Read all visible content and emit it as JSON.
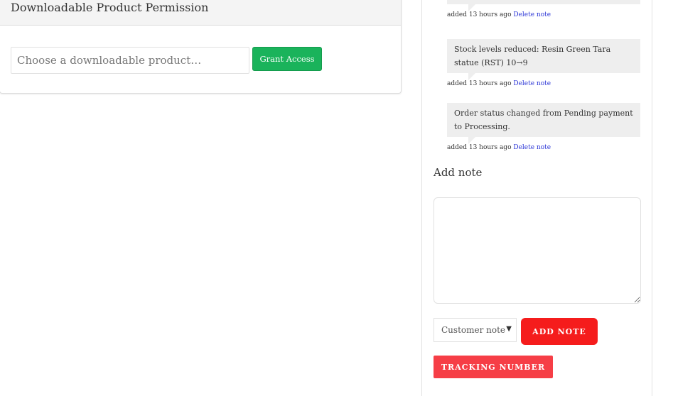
{
  "permission_panel": {
    "title": "Downloadable Product Permission",
    "product_input_placeholder": "Choose a downloadable product…",
    "grant_button_label": "Grant Access"
  },
  "notes": {
    "items": [
      {
        "text": "",
        "meta_prefix": "added 13 hours ago",
        "delete_label": "Delete note"
      },
      {
        "text": "Stock levels reduced: Resin Green Tara statue (RST) 10→9",
        "meta_prefix": "added 13 hours ago",
        "delete_label": "Delete note"
      },
      {
        "text": "Order status changed from Pending payment to Processing.",
        "meta_prefix": "added 13 hours ago",
        "delete_label": "Delete note"
      }
    ],
    "add_note_title": "Add note",
    "note_type_selected": "Customer note",
    "add_note_button": "ADD NOTE",
    "tracking_button": "TRACKING NUMBER"
  },
  "colors": {
    "grant_button": "#1ab35b",
    "add_note_button": "#f51c1c",
    "tracking_button": "#f63e46",
    "delete_link": "#2b35d6",
    "note_bubble": "#eeeeee"
  },
  "icons": {
    "select_arrow": "dropdown-triangle-icon"
  }
}
